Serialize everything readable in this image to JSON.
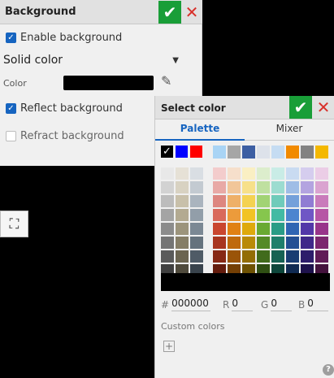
{
  "background_panel": {
    "title": "Background",
    "enable_label": "Enable background",
    "mode_value": "Solid color",
    "color_label": "Color",
    "reflect_label": "Reflect background",
    "refract_label": "Refract background"
  },
  "dialog": {
    "title": "Select color",
    "tabs": [
      "Palette",
      "Mixer"
    ],
    "hex_label": "#",
    "hex_value": "000000",
    "r_label": "R",
    "r_value": "0",
    "g_label": "G",
    "g_value": "0",
    "b_label": "B",
    "b_value": "0",
    "custom_colors_label": "Custom colors",
    "recent_colors": [
      "#000000",
      "#0000ff",
      "#ff0000"
    ],
    "top_palette": [
      "#a9d4f5",
      "#a6a6a6",
      "#3d5fa3",
      "#dde2ea",
      "#c5dcf2",
      "#f18a00",
      "#828282",
      "#f4b800"
    ],
    "gray_grid": [
      [
        "#e8e8e8",
        "#e6e1d6",
        "#d9dee3"
      ],
      [
        "#d2d2d2",
        "#d8d2c2",
        "#c3cad1"
      ],
      [
        "#bcbcbc",
        "#c8c0aa",
        "#aab4be"
      ],
      [
        "#a4a4a4",
        "#b3aa91",
        "#929ea9"
      ],
      [
        "#8c8c8c",
        "#9c947c",
        "#7b8894"
      ],
      [
        "#747474",
        "#857d66",
        "#65727d"
      ],
      [
        "#5a5a5a",
        "#6b6450",
        "#4f5b66"
      ],
      [
        "#404040",
        "#4f4a3c",
        "#39434c"
      ]
    ],
    "color_grid": [
      [
        "#f3cccc",
        "#f6dfcb",
        "#faefc3",
        "#dcedcc",
        "#c9ece6",
        "#c9dbf1",
        "#d5cdee",
        "#ebcde6"
      ],
      [
        "#e8a9a6",
        "#f1c699",
        "#f7e08a",
        "#bfe0a0",
        "#9cdcd0",
        "#9fbde6",
        "#b3a4e0",
        "#daa3d0"
      ],
      [
        "#dd8680",
        "#eeb068",
        "#f4d252",
        "#a2d374",
        "#6fcbba",
        "#74a0da",
        "#907cd3",
        "#c97bbb"
      ],
      [
        "#d96a5c",
        "#ec9b3b",
        "#f2c324",
        "#86c64d",
        "#42baa4",
        "#4c84cf",
        "#6f57c5",
        "#b656a5"
      ],
      [
        "#c9462f",
        "#e08114",
        "#dea90c",
        "#69a932",
        "#2a9c86",
        "#2f65b3",
        "#5237a8",
        "#98348a"
      ],
      [
        "#a8351f",
        "#bf6a0c",
        "#b98a08",
        "#548a26",
        "#1f7f6c",
        "#234f93",
        "#3f2889",
        "#7c266f"
      ],
      [
        "#862815",
        "#9a5408",
        "#936d05",
        "#416b1c",
        "#166253",
        "#193c72",
        "#2d1c6a",
        "#601b56"
      ],
      [
        "#641c0d",
        "#743f04",
        "#6e5203",
        "#2f4f13",
        "#0d463b",
        "#102a52",
        "#1e124c",
        "#44123d"
      ]
    ]
  }
}
